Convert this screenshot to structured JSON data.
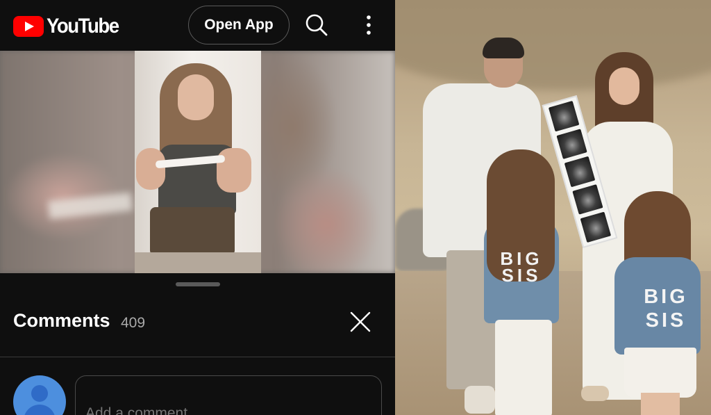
{
  "header": {
    "logo_text": "YouTube",
    "open_app_label": "Open App",
    "icons": [
      "youtube-logo-icon",
      "search-icon",
      "more-vert-icon"
    ]
  },
  "comments_panel": {
    "title": "Comments",
    "count": "409",
    "input_placeholder": "Add a comment...",
    "icons": [
      "close-icon",
      "avatar-icon"
    ]
  },
  "photo": {
    "shirt_text_left": "BIG SIS",
    "shirt_text_right": "BIG SIS"
  },
  "colors": {
    "background": "#0f0f0f",
    "brand_red": "#ff0000",
    "secondary_text": "#aaaaaa",
    "avatar_blue": "#4d8fde"
  }
}
